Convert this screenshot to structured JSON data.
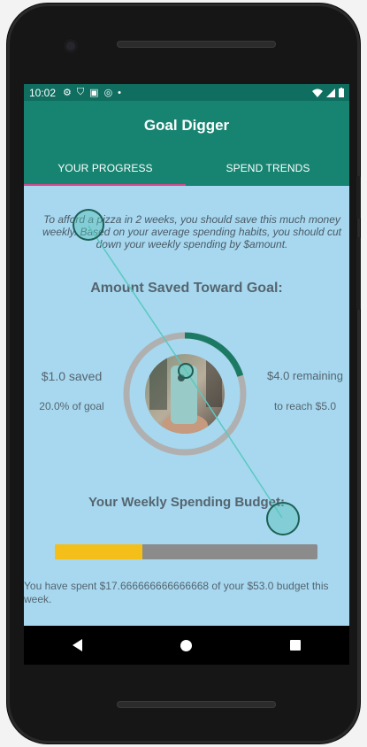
{
  "status_bar": {
    "time": "10:02"
  },
  "app": {
    "title": "Goal Digger"
  },
  "tabs": [
    {
      "label": "YOUR PROGRESS",
      "active": true
    },
    {
      "label": "SPEND TRENDS",
      "active": false
    }
  ],
  "progress": {
    "intro": "To afford a pizza in 2 weeks, you should save this much money weekly. Based on your average spending habits, you should cut down your weekly spending by $amount.",
    "saved_heading": "Amount Saved Toward Goal:",
    "saved": "$1.0 saved",
    "saved_pct": "20.0% of goal",
    "remaining": "$4.0 remaining",
    "reach": "to reach $5.0",
    "goal_progress": 0.2,
    "budget_heading": "Your Weekly Spending Budget:",
    "budget_fill": 0.333,
    "spent_text": "You have spent $17.666666666666668 of your $53.0 budget this week."
  },
  "colors": {
    "app_bar": "#178472",
    "status_bar": "#0f6e60",
    "tab_indicator": "#d64a8f",
    "screen_bg": "#a7d8ef",
    "ring_progress": "#1c7a64",
    "ring_track": "#b0b0b0",
    "budget_fill": "#f5bf1a",
    "budget_track": "#8b8b8b"
  }
}
